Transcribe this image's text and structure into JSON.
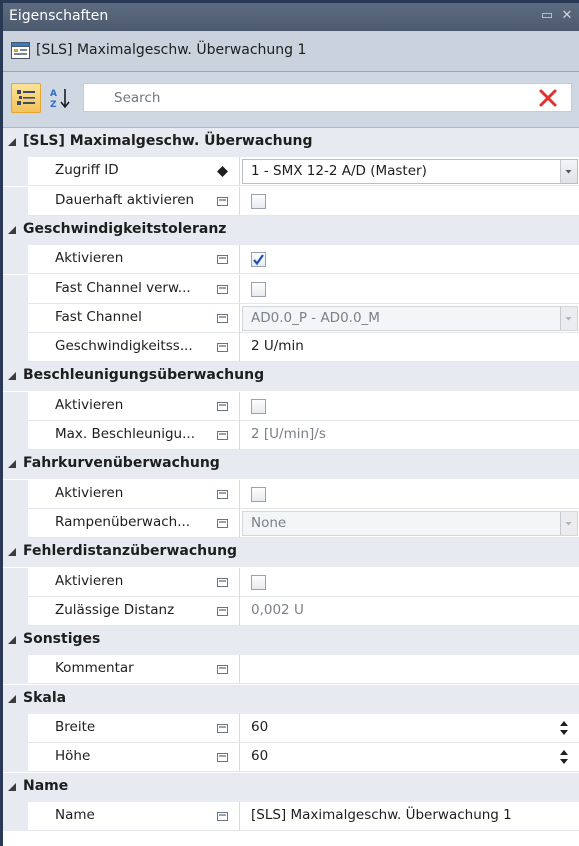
{
  "window": {
    "title": "Eigenschaften",
    "maximize_glyph": "▭",
    "close_glyph": "✕"
  },
  "object": {
    "title": "[SLS] Maximalgeschw. Überwachung 1",
    "icon": "component-icon"
  },
  "toolbar": {
    "search_placeholder": "Search",
    "sort_categorized_icon": "categorized-icon",
    "sort_alpha_icon": "sort-alpha-icon",
    "clear_icon": "clear-icon"
  },
  "colors": {
    "titlebar": "#4d5a6e",
    "category_bg": "#e7ebf1",
    "clear_red": "#e03030",
    "toolbar_active": "#f4c35a"
  },
  "categories": [
    {
      "label": "[SLS] Maximalgeschw. Überwachung",
      "rows": [
        {
          "name": "Zugriff ID",
          "marker": "diamond",
          "type": "combo",
          "value": "1 - SMX 12-2 A/D (Master)"
        },
        {
          "name": "Dauerhaft aktivieren",
          "marker": "box",
          "type": "checkbox",
          "checked": false
        }
      ]
    },
    {
      "label": "Geschwindigkeitstoleranz",
      "rows": [
        {
          "name": "Aktivieren",
          "marker": "box",
          "type": "checkbox",
          "checked": true
        },
        {
          "name": "Fast Channel verw...",
          "marker": "box",
          "type": "checkbox",
          "checked": false
        },
        {
          "name": "Fast Channel",
          "marker": "box",
          "type": "combo-disabled",
          "value": "AD0.0_P - AD0.0_M"
        },
        {
          "name": "Geschwindigkeitss...",
          "marker": "box",
          "type": "text",
          "value": "2 U/min"
        }
      ]
    },
    {
      "label": "Beschleunigungsüberwachung",
      "rows": [
        {
          "name": "Aktivieren",
          "marker": "box",
          "type": "checkbox",
          "checked": false
        },
        {
          "name": "Max. Beschleunigu...",
          "marker": "box",
          "type": "text-muted",
          "value": "2 [U/min]/s"
        }
      ]
    },
    {
      "label": "Fahrkurvenüberwachung",
      "rows": [
        {
          "name": "Aktivieren",
          "marker": "box",
          "type": "checkbox",
          "checked": false
        },
        {
          "name": "Rampenüberwach...",
          "marker": "box",
          "type": "combo-disabled",
          "value": "None"
        }
      ]
    },
    {
      "label": "Fehlerdistanzüberwachung",
      "rows": [
        {
          "name": "Aktivieren",
          "marker": "box",
          "type": "checkbox",
          "checked": false
        },
        {
          "name": "Zulässige Distanz",
          "marker": "box",
          "type": "text-muted",
          "value": "0,002 U"
        }
      ]
    },
    {
      "label": "Sonstiges",
      "rows": [
        {
          "name": "Kommentar",
          "marker": "box",
          "type": "text",
          "value": ""
        }
      ]
    },
    {
      "label": "Skala",
      "rows": [
        {
          "name": "Breite",
          "marker": "box",
          "type": "spin",
          "value": "60"
        },
        {
          "name": "Höhe",
          "marker": "box",
          "type": "spin",
          "value": "60"
        }
      ]
    },
    {
      "label": "Name",
      "rows": [
        {
          "name": "Name",
          "marker": "box",
          "type": "text",
          "value": "[SLS] Maximalgeschw. Überwachung 1"
        }
      ]
    }
  ]
}
